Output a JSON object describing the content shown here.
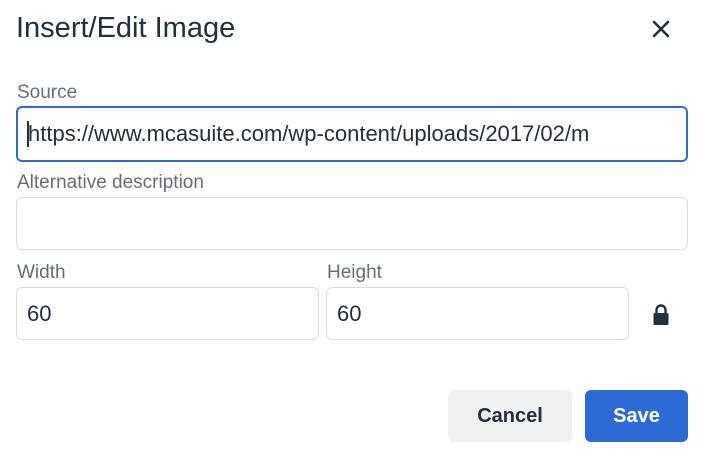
{
  "dialog": {
    "title": "Insert/Edit Image",
    "close_icon": "close-icon"
  },
  "source": {
    "label": "Source",
    "value": "https://www.mcasuite.com/wp-content/uploads/2017/02/m"
  },
  "alt": {
    "label": "Alternative description",
    "value": ""
  },
  "width": {
    "label": "Width",
    "value": "60"
  },
  "height": {
    "label": "Height",
    "value": "60"
  },
  "lock_icon": "lock-icon",
  "buttons": {
    "cancel": "Cancel",
    "save": "Save"
  },
  "colors": {
    "accent": "#2c6bd6",
    "text": "#222f3e",
    "border": "#d8dde3",
    "cancel_bg": "#f0f0f0"
  }
}
